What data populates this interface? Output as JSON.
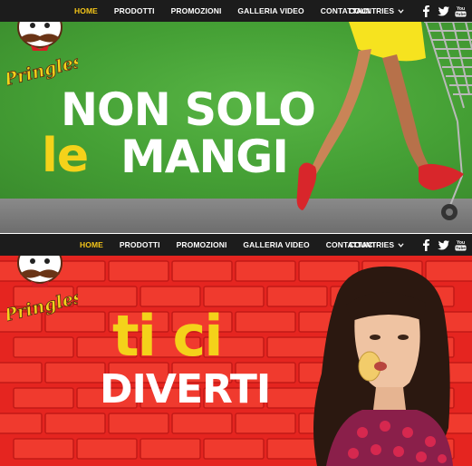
{
  "panel1": {
    "nav": {
      "items": [
        {
          "label": "HOME",
          "active": true
        },
        {
          "label": "PRODOTTI",
          "active": false
        },
        {
          "label": "PROMOZIONI",
          "active": false
        },
        {
          "label": "GALLERIA VIDEO",
          "active": false
        },
        {
          "label": "CONTATTACI",
          "active": false
        }
      ],
      "countries_label": "COUNTRIES",
      "social_icons": [
        "facebook-icon",
        "twitter-icon",
        "youtube-icon"
      ]
    },
    "logo_text": "Pringles",
    "headline": {
      "line1": "NON SOLO",
      "line2_a": "le",
      "line2_b": "MANGI"
    }
  },
  "panel2": {
    "nav": {
      "items": [
        {
          "label": "HOME",
          "active": true
        },
        {
          "label": "PRODOTTI",
          "active": false
        },
        {
          "label": "PROMOZIONI",
          "active": false
        },
        {
          "label": "GALLERIA VIDEO",
          "active": false
        },
        {
          "label": "CONTATTACI",
          "active": false
        }
      ],
      "countries_label": "COUNTRIES",
      "social_icons": [
        "facebook-icon",
        "twitter-icon",
        "youtube-icon"
      ]
    },
    "logo_text": "Pringles",
    "headline": {
      "line1": "ti ci",
      "line2": "DIVERTI"
    }
  },
  "colors": {
    "nav_bg": "#1c1c1c",
    "nav_active": "#f4c518",
    "panel1_bg": "#4aa53a",
    "panel2_bg": "#e8251f",
    "headline_yellow": "#f4d21a",
    "logo_red": "#d61f26"
  },
  "youtube_label": "You Tube"
}
